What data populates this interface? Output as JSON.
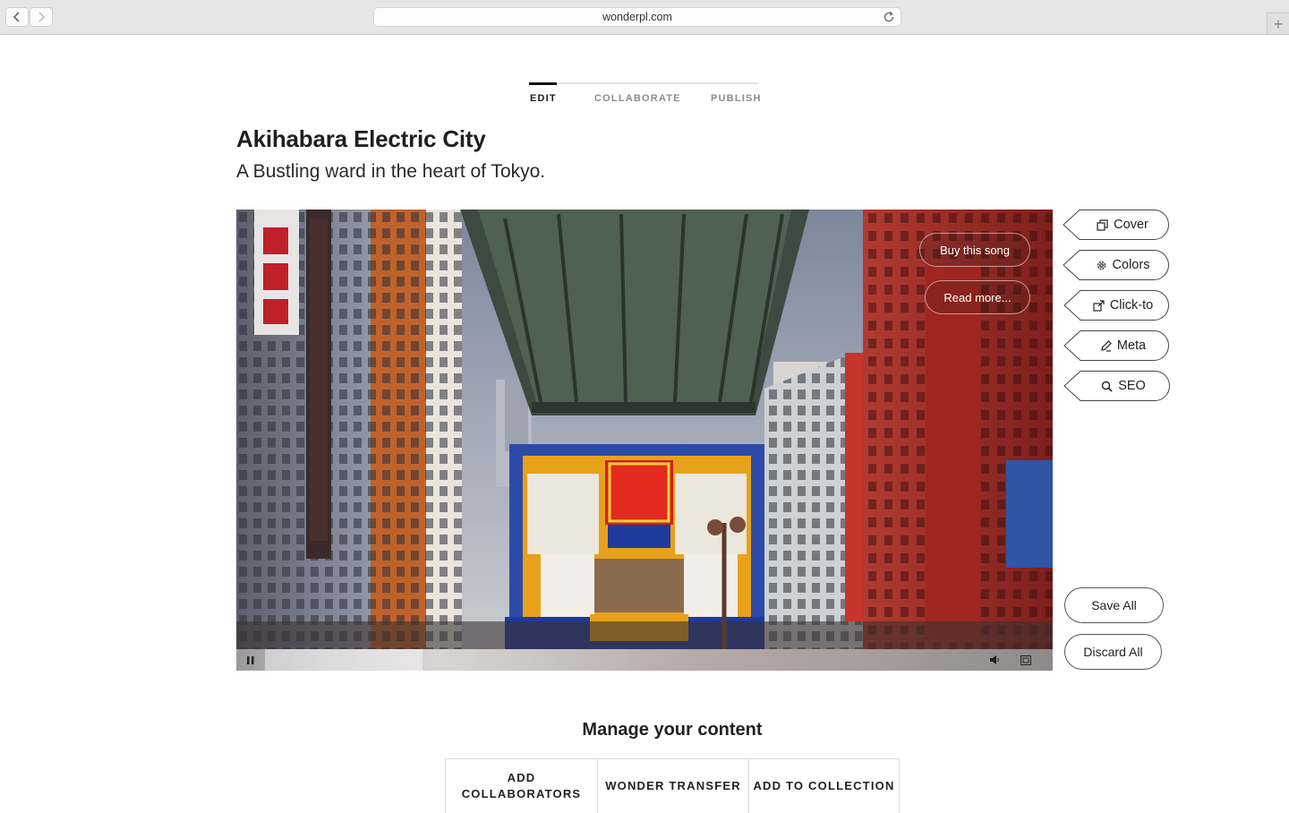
{
  "browser": {
    "url": "wonderpl.com",
    "back_icon": "chevron-left-icon",
    "forward_icon": "chevron-right-icon",
    "reload_icon": "reload-icon",
    "new_tab_label": "+"
  },
  "steps": {
    "items": [
      {
        "label": "EDIT",
        "active": true
      },
      {
        "label": "COLLABORATE",
        "active": false
      },
      {
        "label": "PUBLISH",
        "active": false
      }
    ]
  },
  "story": {
    "title": "Akihabara Electric City",
    "subtitle": "A Bustling ward in the heart of Tokyo."
  },
  "media": {
    "overlay_buttons": [
      "Buy this song",
      "Read more..."
    ],
    "playback_state": "playing",
    "progress_buffered": 0.22,
    "controls_icons": [
      "pause-icon",
      "volume-icon",
      "fullscreen-icon"
    ]
  },
  "side_panel": {
    "tools": [
      {
        "label": "Cover",
        "icon": "cover-icon"
      },
      {
        "label": "Colors",
        "icon": "gear-icon"
      },
      {
        "label": "Click-to",
        "icon": "link-icon"
      },
      {
        "label": "Meta",
        "icon": "pencil-icon"
      },
      {
        "label": "SEO",
        "icon": "search-icon"
      }
    ],
    "save_label": "Save All",
    "discard_label": "Discard All"
  },
  "manage": {
    "title": "Manage your content",
    "tabs": [
      "ADD\nCOLLABORATORS",
      "WONDER TRANSFER",
      "ADD TO COLLECTION"
    ]
  }
}
